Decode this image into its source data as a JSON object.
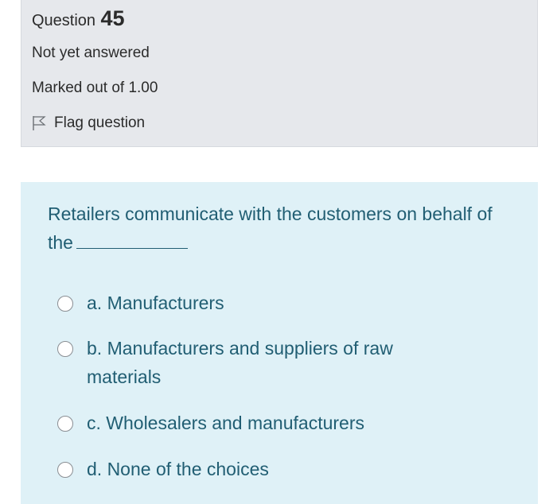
{
  "question_info": {
    "word": "Question",
    "number": "45",
    "state": "Not yet answered",
    "grade": "Marked out of 1.00",
    "flag_label": "Flag question",
    "flag_icon": "flag-icon"
  },
  "question": {
    "text": "Retailers communicate with the customers on behalf of the"
  },
  "answers": [
    {
      "label": "a. Manufacturers"
    },
    {
      "label": "b. Manufacturers and suppliers of raw materials"
    },
    {
      "label": "c. Wholesalers and manufacturers"
    },
    {
      "label": "d. None of the choices"
    }
  ],
  "colors": {
    "info_bg": "#e6e8ec",
    "content_bg": "#dff1f7",
    "text_accent": "#215e73"
  }
}
